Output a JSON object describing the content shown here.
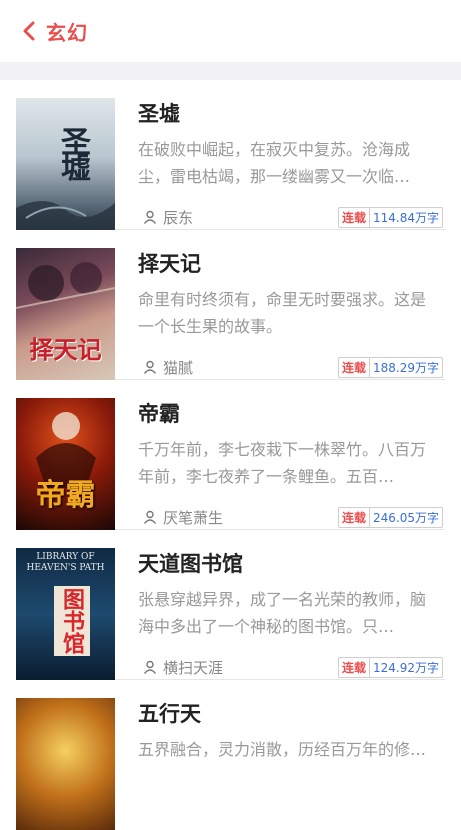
{
  "header": {
    "title": "玄幻",
    "back_icon": "chevron-left-icon",
    "accent": "#e94e4e"
  },
  "books": [
    {
      "title": "圣墟",
      "description": "在破败中崛起，在寂灭中复苏。沧海成尘，雷电枯竭，那一缕幽雾又一次临…",
      "author": "辰东",
      "status": "连载",
      "word_count": "114.84万字",
      "cover_text": "圣墟"
    },
    {
      "title": "择天记",
      "description": "命里有时终须有，命里无时要强求。这是一个长生果的故事。",
      "author": "猫腻",
      "status": "连载",
      "word_count": "188.29万字",
      "cover_text": "择天记"
    },
    {
      "title": "帝霸",
      "description": "千万年前，李七夜栽下一株翠竹。八百万年前，李七夜养了一条鲤鱼。五百…",
      "author": "厌笔萧生",
      "status": "连载",
      "word_count": "246.05万字",
      "cover_text": "帝霸"
    },
    {
      "title": "天道图书馆",
      "description": "张悬穿越异界，成了一名光荣的教师，脑海中多出了一个神秘的图书馆。只…",
      "author": "横扫天涯",
      "status": "连载",
      "word_count": "124.92万字",
      "cover_text": "图书馆",
      "cover_subtext": "LIBRARY OF HEAVEN'S PATH"
    },
    {
      "title": "五行天",
      "description": "五界融合，灵力消散，历经百万年的修…",
      "author": "",
      "status": "",
      "word_count": "",
      "cover_text": ""
    }
  ]
}
